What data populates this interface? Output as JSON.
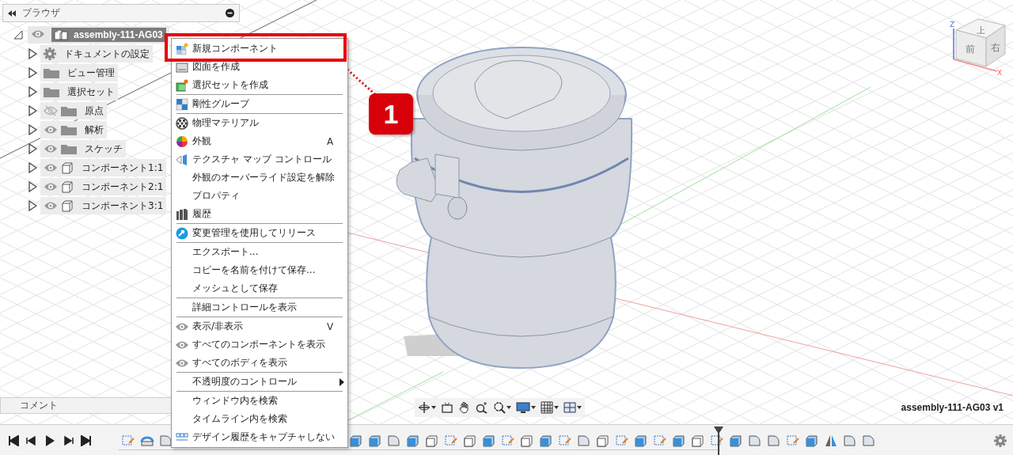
{
  "browser": {
    "title": "ブラウザ",
    "root": {
      "label": "assembly-111-AG03",
      "expanded": true,
      "visible": true
    },
    "items": [
      {
        "label": "ドキュメントの設定",
        "kind": "settings",
        "expanded": false
      },
      {
        "label": "ビュー管理",
        "kind": "folder",
        "expanded": false
      },
      {
        "label": "選択セット",
        "kind": "folder",
        "expanded": false
      },
      {
        "label": "原点",
        "kind": "folder",
        "expanded": false,
        "visible": false
      },
      {
        "label": "解析",
        "kind": "folder",
        "expanded": false,
        "visible": true
      },
      {
        "label": "スケッチ",
        "kind": "folder",
        "expanded": false,
        "visible": true
      },
      {
        "label": "コンポーネント1:1",
        "kind": "component",
        "expanded": false,
        "visible": true
      },
      {
        "label": "コンポーネント2:1",
        "kind": "component",
        "expanded": false,
        "visible": true
      },
      {
        "label": "コンポーネント3:1",
        "kind": "component",
        "expanded": false,
        "visible": true
      }
    ]
  },
  "comments": {
    "title": "コメント"
  },
  "context_menu": [
    {
      "kind": "item",
      "label": "新規コンポーネント"
    },
    {
      "kind": "item",
      "label": "図面を作成"
    },
    {
      "kind": "item",
      "label": "選択セットを作成"
    },
    {
      "kind": "separator"
    },
    {
      "kind": "item",
      "label": "剛性グループ"
    },
    {
      "kind": "separator"
    },
    {
      "kind": "item",
      "label": "物理マテリアル"
    },
    {
      "kind": "item",
      "label": "外観",
      "shortcut": "A"
    },
    {
      "kind": "item",
      "label": "テクスチャ マップ コントロール"
    },
    {
      "kind": "item",
      "label": "外観のオーバーライド設定を解除"
    },
    {
      "kind": "item",
      "label": "プロパティ"
    },
    {
      "kind": "item",
      "label": "履歴"
    },
    {
      "kind": "separator"
    },
    {
      "kind": "item",
      "label": "変更管理を使用してリリース"
    },
    {
      "kind": "separator"
    },
    {
      "kind": "item",
      "label": "エクスポート..."
    },
    {
      "kind": "item",
      "label": "コピーを名前を付けて保存..."
    },
    {
      "kind": "item",
      "label": "メッシュとして保存"
    },
    {
      "kind": "separator"
    },
    {
      "kind": "item",
      "label": "詳細コントロールを表示"
    },
    {
      "kind": "separator"
    },
    {
      "kind": "item",
      "label": "表示/非表示",
      "shortcut": "V"
    },
    {
      "kind": "item",
      "label": "すべてのコンポーネントを表示"
    },
    {
      "kind": "item",
      "label": "すべてのボディを表示"
    },
    {
      "kind": "separator"
    },
    {
      "kind": "item",
      "label": "不透明度のコントロール",
      "submenu": true
    },
    {
      "kind": "separator"
    },
    {
      "kind": "item",
      "label": "ウィンドウ内を検索"
    },
    {
      "kind": "item",
      "label": "タイムライン内を検索"
    },
    {
      "kind": "item",
      "label": "デザイン履歴をキャプチャしない"
    }
  ],
  "callout": {
    "number": "1"
  },
  "viewcube": {
    "top": "上",
    "front": "前",
    "right": "右",
    "z_axis": "Z",
    "x_axis": "X"
  },
  "document_label": "assembly-111-AG03 v1"
}
